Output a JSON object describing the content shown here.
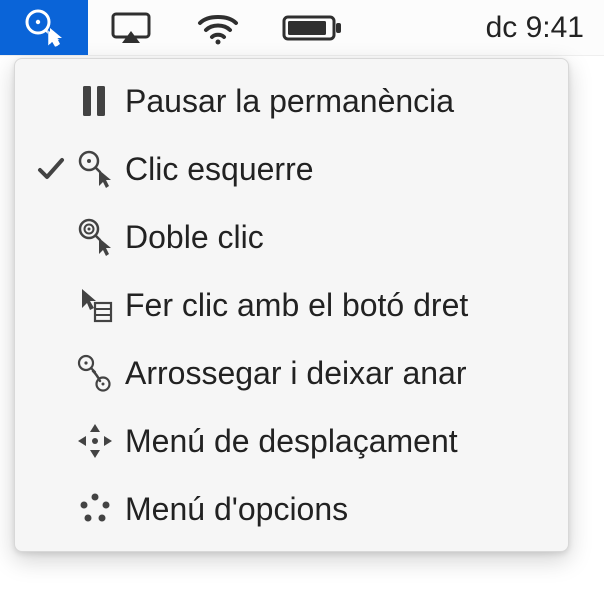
{
  "menubar": {
    "clock": "dc 9:41"
  },
  "menu": {
    "items": [
      {
        "label": "Pausar la permanència"
      },
      {
        "label": "Clic esquerre"
      },
      {
        "label": "Doble clic"
      },
      {
        "label": "Fer clic amb el botó dret"
      },
      {
        "label": "Arrossegar i deixar anar"
      },
      {
        "label": "Menú de desplaçament"
      },
      {
        "label": "Menú d'opcions"
      }
    ],
    "selected_index": 1
  }
}
